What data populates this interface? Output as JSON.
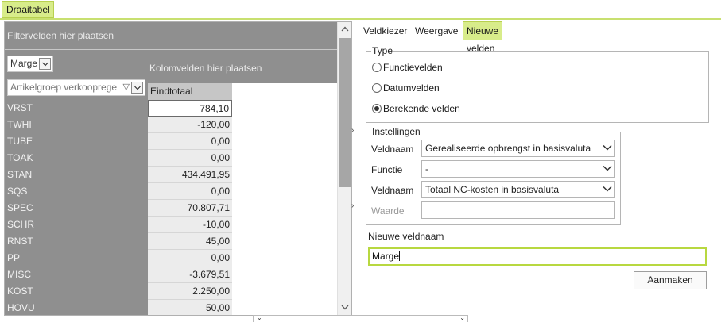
{
  "top_tab": {
    "label": "Draaitabel"
  },
  "pivot": {
    "filter_placeholder": "Filtervelden hier plaatsen",
    "column_placeholder": "Kolomvelden hier plaatsen",
    "value_field": "Marge",
    "row_field": "Artikelgroep verkooprege",
    "total_header": "Eindtotaal",
    "rows": [
      {
        "label": "VRST",
        "value": "784,10"
      },
      {
        "label": "TWHI",
        "value": "-120,00"
      },
      {
        "label": "TUBE",
        "value": "0,00"
      },
      {
        "label": "TOAK",
        "value": "0,00"
      },
      {
        "label": "STAN",
        "value": "434.491,95"
      },
      {
        "label": "SQS",
        "value": "0,00"
      },
      {
        "label": "SPEC",
        "value": "70.807,71"
      },
      {
        "label": "SCHR",
        "value": "-10,00"
      },
      {
        "label": "RNST",
        "value": "45,00"
      },
      {
        "label": "PP",
        "value": "0,00"
      },
      {
        "label": "MISC",
        "value": "-3.679,51"
      },
      {
        "label": "KOST",
        "value": "2.250,00"
      },
      {
        "label": "HOVU",
        "value": "50,00"
      }
    ]
  },
  "right_tabs": [
    {
      "label": "Veldkiezer",
      "active": false
    },
    {
      "label": "Weergave",
      "active": false
    },
    {
      "label": "Nieuwe velden",
      "active": true
    }
  ],
  "type_group": {
    "legend": "Type",
    "options": [
      {
        "label": "Functievelden",
        "selected": false
      },
      {
        "label": "Datumvelden",
        "selected": false
      },
      {
        "label": "Berekende velden",
        "selected": true
      }
    ]
  },
  "settings_group": {
    "legend": "Instellingen",
    "veldnaam1_label": "Veldnaam",
    "veldnaam1_value": "Gerealiseerde opbrengst in basisvaluta",
    "functie_label": "Functie",
    "functie_value": "-",
    "veldnaam2_label": "Veldnaam",
    "veldnaam2_value": "Totaal NC-kosten in basisvaluta",
    "waarde_label": "Waarde",
    "waarde_value": ""
  },
  "new_field": {
    "label": "Nieuwe veldnaam",
    "value": "Marge"
  },
  "create_button": {
    "label": "Aanmaken"
  },
  "colors": {
    "accent": "#d8ec8a",
    "accent_border": "#b8d050",
    "pivot_header_gray": "#8f8f8f"
  }
}
